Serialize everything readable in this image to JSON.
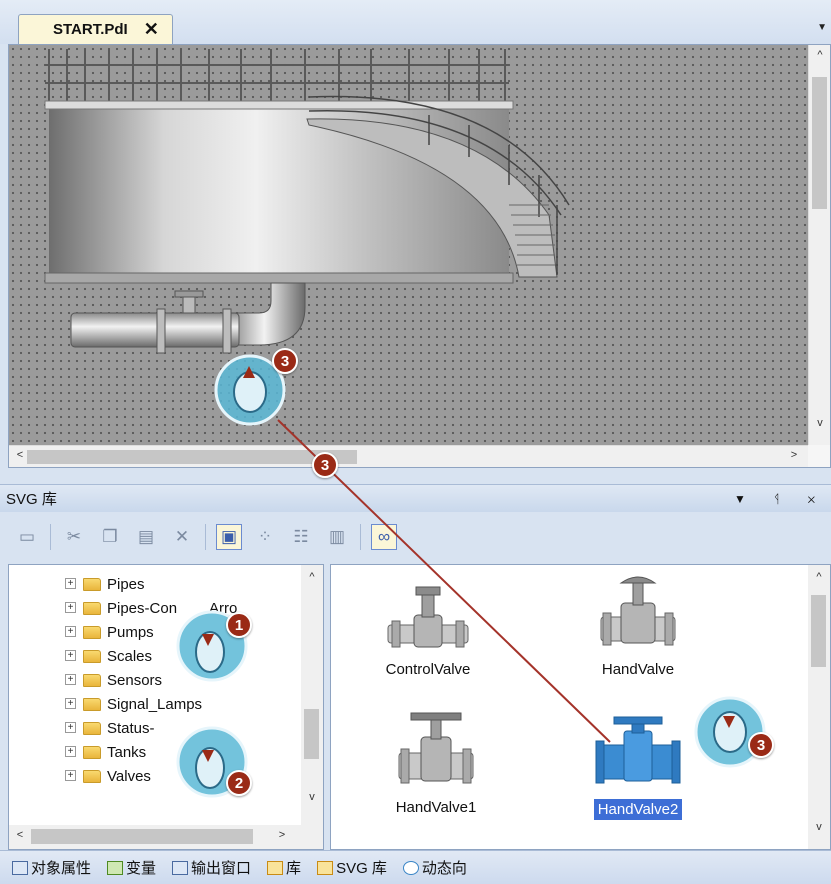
{
  "document": {
    "tab_title": "START.PdI",
    "close_glyph": "✕",
    "strip_menu_glyph": "▼"
  },
  "editor": {
    "scroll_up": "^",
    "scroll_down": "v",
    "scroll_left": "<",
    "scroll_right": ">"
  },
  "svg_panel": {
    "title": "SVG 库",
    "controls": "▼ ᛩ ✕",
    "toolbar_icons": [
      "new-folder-icon",
      "cut-icon",
      "copy-icon",
      "paste-icon",
      "delete-icon",
      "large-icons-view-icon",
      "small-icons-view-icon",
      "list-view-icon",
      "details-view-icon",
      "preview-icon"
    ],
    "tree": {
      "items": [
        {
          "label": "Pipes"
        },
        {
          "label": "Pipes-Con"
        },
        {
          "label": "Pumps"
        },
        {
          "label": "Scales"
        },
        {
          "label": "Sensors"
        },
        {
          "label": "Signal_Lamps"
        },
        {
          "label": "Status-"
        },
        {
          "label": "Tanks"
        },
        {
          "label": "Valves"
        }
      ],
      "overflow_text": "Arro",
      "scroll_left": "<",
      "scroll_right": ">",
      "scroll_up": "^",
      "scroll_down": "v"
    },
    "library_items": [
      {
        "label": "ControlValve"
      },
      {
        "label": "HandValve"
      },
      {
        "label": "HandValve1"
      },
      {
        "label": "HandValve2"
      }
    ],
    "items_scroll_up": "^",
    "items_scroll_down": "v"
  },
  "bottom_tabs": [
    {
      "label": "对象属性",
      "icon": "properties-icon"
    },
    {
      "label": "变量",
      "icon": "tags-icon"
    },
    {
      "label": "输出窗口",
      "icon": "output-window-icon"
    },
    {
      "label": "库",
      "icon": "library-icon"
    },
    {
      "label": "SVG 库",
      "icon": "svg-library-icon"
    },
    {
      "label": "动态向",
      "icon": "dynamic-wizard-icon"
    }
  ],
  "callouts": [
    {
      "number": "1"
    },
    {
      "number": "2"
    },
    {
      "number": "3"
    },
    {
      "number": "3"
    },
    {
      "number": "3"
    }
  ],
  "colors": {
    "accent_selection": "#3d6ed6",
    "callout_badge": "#9a2a16",
    "callout_bubble": "#5ab8d6",
    "drag_line": "#a4332a",
    "valve_blue": "#3b8cd2"
  }
}
